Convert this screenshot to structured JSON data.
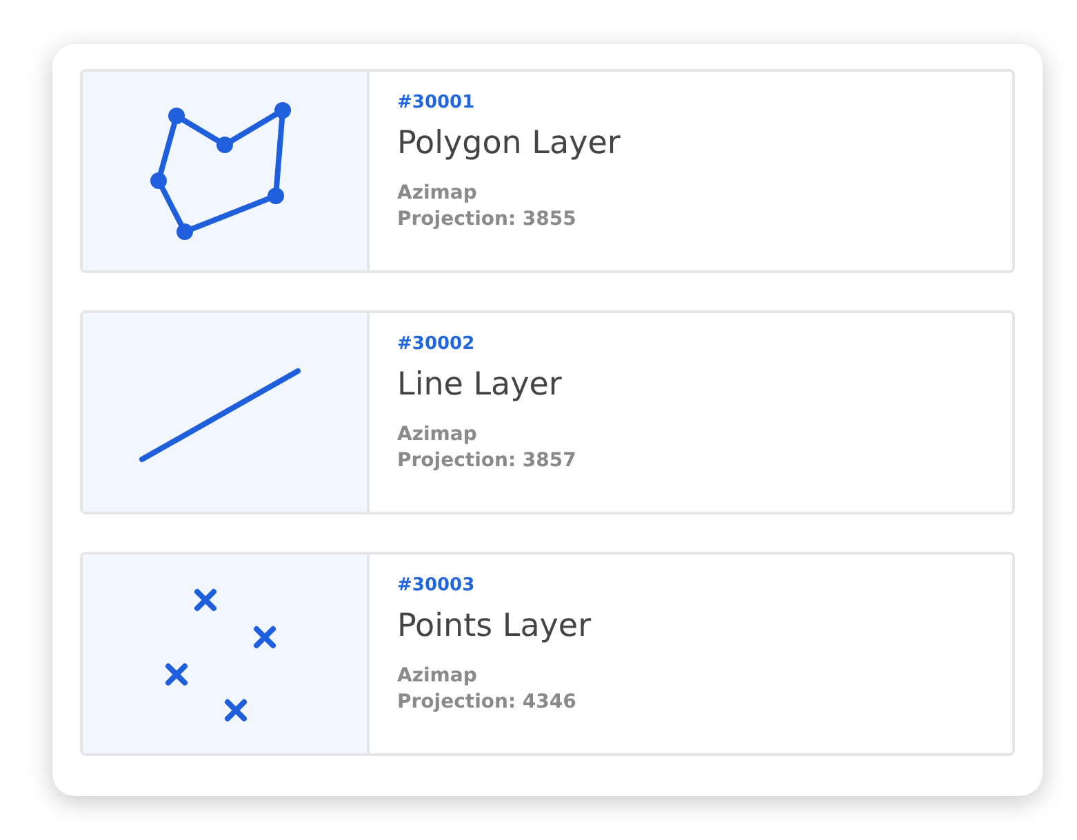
{
  "layers": [
    {
      "kind": "polygon",
      "id": "#30001",
      "title": "Polygon Layer",
      "source": "Azimap",
      "projection": "Projection: 3855"
    },
    {
      "kind": "line",
      "id": "#30002",
      "title": "Line Layer",
      "source": "Azimap",
      "projection": "Projection: 3857"
    },
    {
      "kind": "points",
      "id": "#30003",
      "title": "Points Layer",
      "source": "Azimap",
      "projection": "Projection: 4346"
    }
  ]
}
